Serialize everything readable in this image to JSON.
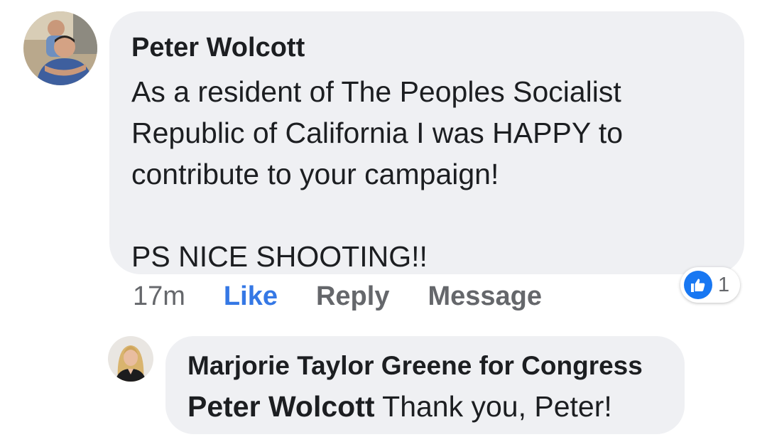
{
  "comment": {
    "author": "Peter Wolcott",
    "body_lines": [
      "As a resident of The Peoples Socialist",
      "Republic of California I was HAPPY to",
      "contribute to your campaign!",
      "",
      "PS NICE SHOOTING!!"
    ],
    "actions": {
      "time": "17m",
      "like": "Like",
      "reply": "Reply",
      "message": "Message"
    },
    "reaction": {
      "icon": "thumbs-up-icon",
      "count": "1",
      "color": "#1877f2"
    }
  },
  "reply": {
    "author": "Marjorie Taylor Greene for Congress",
    "mention": "Peter Wolcott",
    "text": "Thank you, Peter!"
  },
  "colors": {
    "bubble": "#eff0f3",
    "link_blue": "#3578e5",
    "muted": "#65676b",
    "text": "#1c1e21"
  }
}
